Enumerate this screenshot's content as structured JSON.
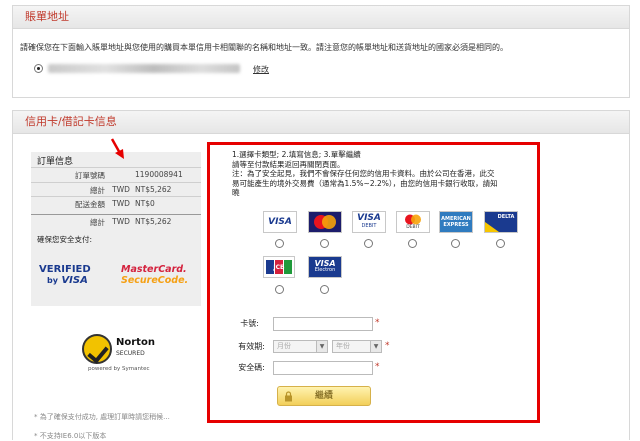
{
  "billing": {
    "title": "賬單地址",
    "notice": "請確保您在下面輸入賬單地址與您使用的購買本單信用卡相關聯的名稱和地址一致。請注意您的帳單地址和送貨地址的國家必須是相同的。",
    "edit_label": "修改"
  },
  "card_section": {
    "title": "信用卡/借記卡信息"
  },
  "order": {
    "title": "訂單信息",
    "rows": [
      {
        "label": "訂單號碼",
        "currency": "",
        "value": "1190008941"
      },
      {
        "label": "總計",
        "currency": "TWD",
        "value": "NT$5,262"
      },
      {
        "label": "配送金額",
        "currency": "TWD",
        "value": "NT$0"
      },
      {
        "label": "總計",
        "currency": "TWD",
        "value": "NT$5,262"
      }
    ],
    "secure_label": "確保您安全支付:",
    "vbv_line1": "VERIFIED",
    "vbv_line2_by": "by",
    "vbv_line2_visa": "VISA",
    "msc_line1": "MasterCard.",
    "msc_line2": "SecureCode."
  },
  "norton": {
    "name": "Norton",
    "sub": "SECURED",
    "powered": "powered by Symantec"
  },
  "footer": {
    "note1": "* 為了確保支付成功, 處理訂單時請您稍候...",
    "note2": "* 不支持IE6.0以下版本"
  },
  "instructions": {
    "line1": "1.選擇卡類型; 2.填寫信息; 3.單擊繼續",
    "line2": "請等至付款結果返回再關閉頁面。",
    "line3": "注：為了安全起見，我們不會保存任何您的信用卡資料。由於公司在香港，此交",
    "line4": "易可能產生的境外交易費（通常為1.5%~2.2%），由您的信用卡銀行收取，請知",
    "line5": "曉"
  },
  "cards": [
    "VISA",
    "MasterCard",
    "VISA DEBIT",
    "Debit MasterCard",
    "American Express",
    "Delta",
    "JCB",
    "VISA Electron"
  ],
  "card_text": {
    "visa": "VISA",
    "visa_debit_top": "VISA",
    "visa_debit_bottom": "DEBIT",
    "debit": "DEBIT",
    "amex_top": "AMERICAN",
    "amex_bottom": "EXPRESS",
    "delta": "DELTA",
    "jcb": "JCB",
    "electron_top": "VISA",
    "electron_bottom": "Electron"
  },
  "form": {
    "card_number_label": "卡號:",
    "expiry_label": "有效期:",
    "month_placeholder": "月份",
    "year_placeholder": "年份",
    "cvv_label": "安全碼:",
    "required_mark": "*",
    "continue_label": "繼續"
  },
  "colors": {
    "section_title": "#c0392b",
    "highlight_border": "#e60000",
    "button": "#f2cf5a"
  }
}
